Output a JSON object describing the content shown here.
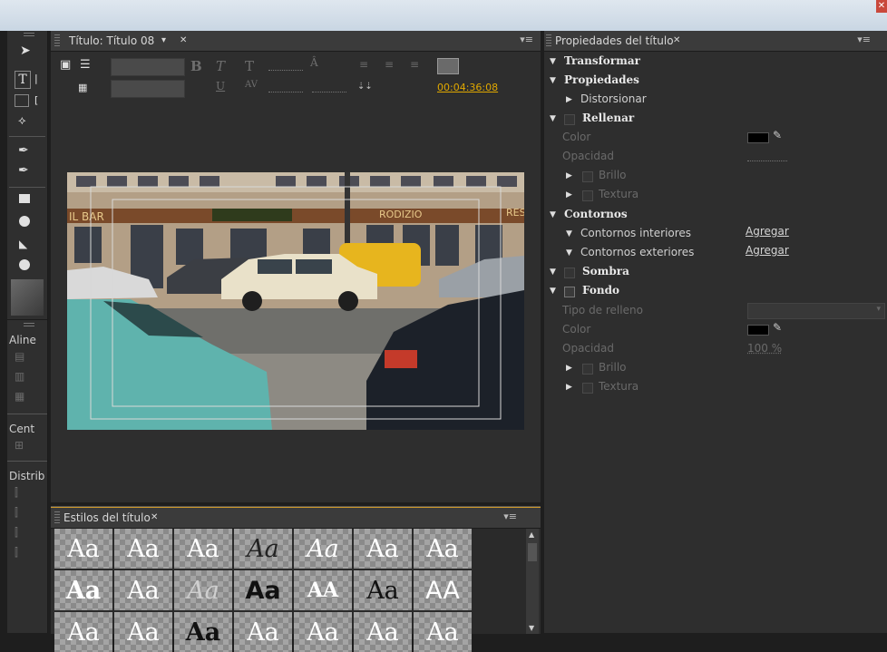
{
  "title_panel": {
    "tab_label": "Título: Título 08",
    "timecode": "00:04:36:08"
  },
  "toolbox": {
    "labels": {
      "align": "Aline",
      "center": "Cent",
      "distribute": "Distrib"
    }
  },
  "styles_panel": {
    "tab_label": "Estilos del título",
    "row1": [
      "Aa",
      "Aa",
      "Aa",
      "Aa",
      "Aa",
      "Aa",
      "Aa"
    ],
    "row2": [
      "Aa",
      "Aa",
      "Aa",
      "Aa",
      "AA",
      "Aa",
      "AA"
    ],
    "row3": [
      "Aa",
      "Aa",
      "Aa",
      "Aa",
      "Aa",
      "Aa",
      "Aa"
    ]
  },
  "properties_panel": {
    "tab_label": "Propiedades del título",
    "transform": "Transformar",
    "properties": "Propiedades",
    "distort": "Distorsionar",
    "fill": "Rellenar",
    "fill_color": "Color",
    "fill_opacity": "Opacidad",
    "fill_sheen": "Brillo",
    "fill_texture": "Textura",
    "strokes": "Contornos",
    "inner_strokes": "Contornos interiores",
    "outer_strokes": "Contornos exteriores",
    "add_inner": "Agregar",
    "add_outer": "Agregar",
    "shadow": "Sombra",
    "background": "Fondo",
    "fill_type": "Tipo de relleno",
    "bg_color": "Color",
    "bg_opacity": "Opacidad",
    "bg_opacity_value": "100 %",
    "bg_sheen": "Brillo",
    "bg_texture": "Textura"
  },
  "icons": [
    "selection-tool-icon",
    "type-tool-icon",
    "vertical-type-tool-icon",
    "pen-tool-icon",
    "rectangle-tool-icon",
    "ellipse-tool-icon",
    "wedge-tool-icon",
    "eyedropper-icon",
    "panel-menu-icon",
    "close-icon"
  ],
  "colors": {
    "accent_timecode": "#e0a800",
    "panel_bg": "#2e2e2e",
    "tab_bg": "#3b3b3b"
  }
}
